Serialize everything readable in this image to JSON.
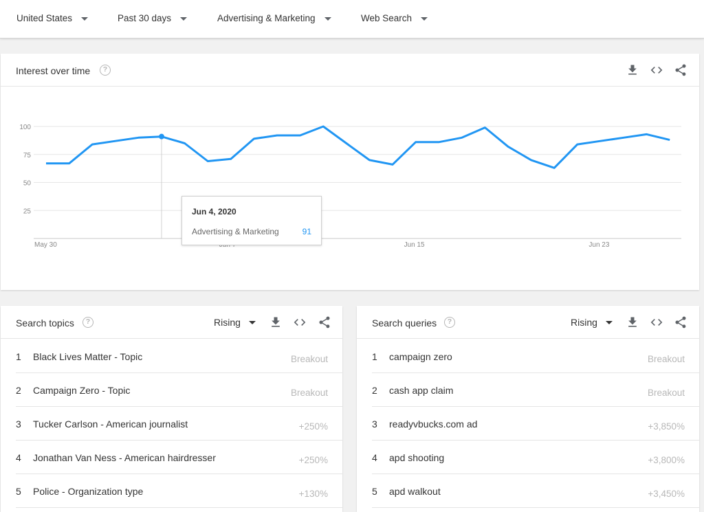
{
  "filters": [
    {
      "label": "United States"
    },
    {
      "label": "Past 30 days"
    },
    {
      "label": "Advertising & Marketing"
    },
    {
      "label": "Web Search"
    }
  ],
  "interest": {
    "title": "Interest over time",
    "help": "?",
    "icons": [
      "download-icon",
      "embed-icon",
      "share-icon"
    ],
    "tooltip": {
      "date": "Jun 4, 2020",
      "series": "Advertising & Marketing",
      "value": "91"
    }
  },
  "chart_data": {
    "type": "line",
    "x": [
      "May 30",
      "May 31",
      "Jun 1",
      "Jun 2",
      "Jun 3",
      "Jun 4",
      "Jun 5",
      "Jun 6",
      "Jun 7",
      "Jun 8",
      "Jun 9",
      "Jun 10",
      "Jun 11",
      "Jun 12",
      "Jun 13",
      "Jun 14",
      "Jun 15",
      "Jun 16",
      "Jun 17",
      "Jun 18",
      "Jun 19",
      "Jun 20",
      "Jun 21",
      "Jun 22",
      "Jun 23",
      "Jun 24",
      "Jun 25",
      "Jun 26"
    ],
    "values": [
      67,
      67,
      84,
      87,
      90,
      91,
      85,
      69,
      71,
      89,
      92,
      92,
      100,
      85,
      70,
      66,
      86,
      86,
      90,
      99,
      82,
      70,
      63,
      84,
      87,
      90,
      93,
      88
    ],
    "x_tick_labels": [
      "May 30",
      "Jun 7",
      "Jun 15",
      "Jun 23"
    ],
    "y_ticks": [
      25,
      50,
      75,
      100
    ],
    "ylim": [
      0,
      100
    ],
    "series_color": "#2196f3",
    "highlight_index": 5,
    "grid": true
  },
  "topics": {
    "title": "Search topics",
    "help": "?",
    "dropdown": "Rising",
    "rows": [
      {
        "num": "1",
        "label": "Black Lives Matter - Topic",
        "value": "Breakout"
      },
      {
        "num": "2",
        "label": "Campaign Zero - Topic",
        "value": "Breakout"
      },
      {
        "num": "3",
        "label": "Tucker Carlson - American journalist",
        "value": "+250%"
      },
      {
        "num": "4",
        "label": "Jonathan Van Ness - American hairdresser",
        "value": "+250%"
      },
      {
        "num": "5",
        "label": "Police - Organization type",
        "value": "+130%"
      }
    ]
  },
  "queries": {
    "title": "Search queries",
    "help": "?",
    "dropdown": "Rising",
    "rows": [
      {
        "num": "1",
        "label": "campaign zero",
        "value": "Breakout"
      },
      {
        "num": "2",
        "label": "cash app claim",
        "value": "Breakout"
      },
      {
        "num": "3",
        "label": "readyvbucks.com ad",
        "value": "+3,850%"
      },
      {
        "num": "4",
        "label": "apd shooting",
        "value": "+3,800%"
      },
      {
        "num": "5",
        "label": "apd walkout",
        "value": "+3,450%"
      }
    ]
  }
}
